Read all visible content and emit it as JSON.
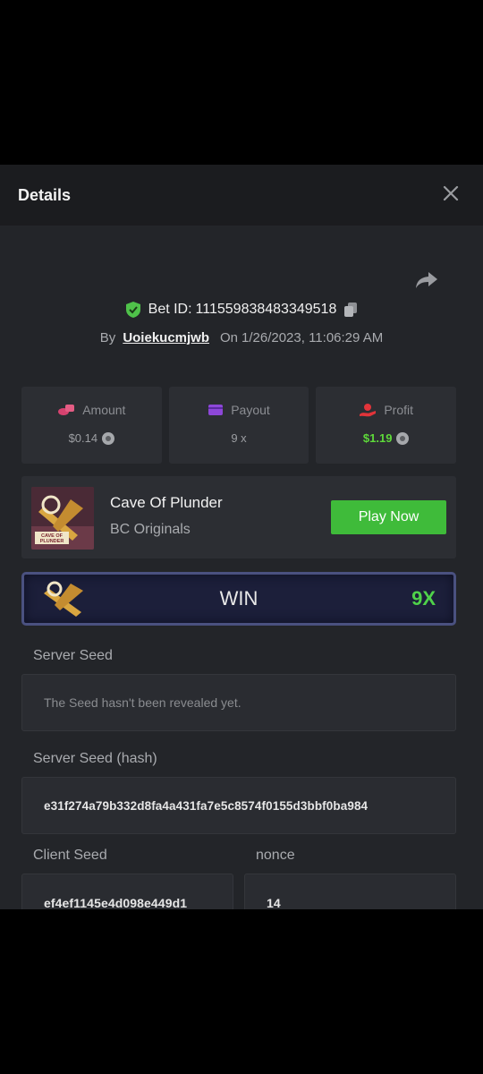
{
  "header": {
    "title": "Details"
  },
  "bet": {
    "id_label": "Bet ID:",
    "id": "111559838483349518",
    "by_label": "By",
    "user": "Uoiekucmjwb",
    "on_label": "On",
    "datetime": "1/26/2023, 11:06:29 AM"
  },
  "stats": {
    "amount": {
      "label": "Amount",
      "value": "$0.14",
      "icon": "amount-icon"
    },
    "payout": {
      "label": "Payout",
      "value": "9 x",
      "icon": "payout-icon"
    },
    "profit": {
      "label": "Profit",
      "value": "$1.19",
      "icon": "profit-icon"
    }
  },
  "game": {
    "name": "Cave Of Plunder",
    "provider": "BC Originals",
    "thumb_text": "CAVE OF PLUNDER",
    "play_label": "Play Now"
  },
  "result": {
    "label": "WIN",
    "multiplier": "9X"
  },
  "seeds": {
    "server_seed_label": "Server Seed",
    "server_seed_value": "The Seed hasn't been revealed yet.",
    "server_hash_label": "Server Seed (hash)",
    "server_hash_value": "e31f274a79b332d8fa4a431fa7e5c8574f0155d3bbf0ba984",
    "client_seed_label": "Client Seed",
    "client_seed_value": "ef4ef1145e4d098e449d1",
    "nonce_label": "nonce",
    "nonce_value": "14"
  },
  "colors": {
    "accent_green": "#3fbb3a",
    "profit_green": "#5ed93a",
    "shield_green": "#4fc24a"
  }
}
